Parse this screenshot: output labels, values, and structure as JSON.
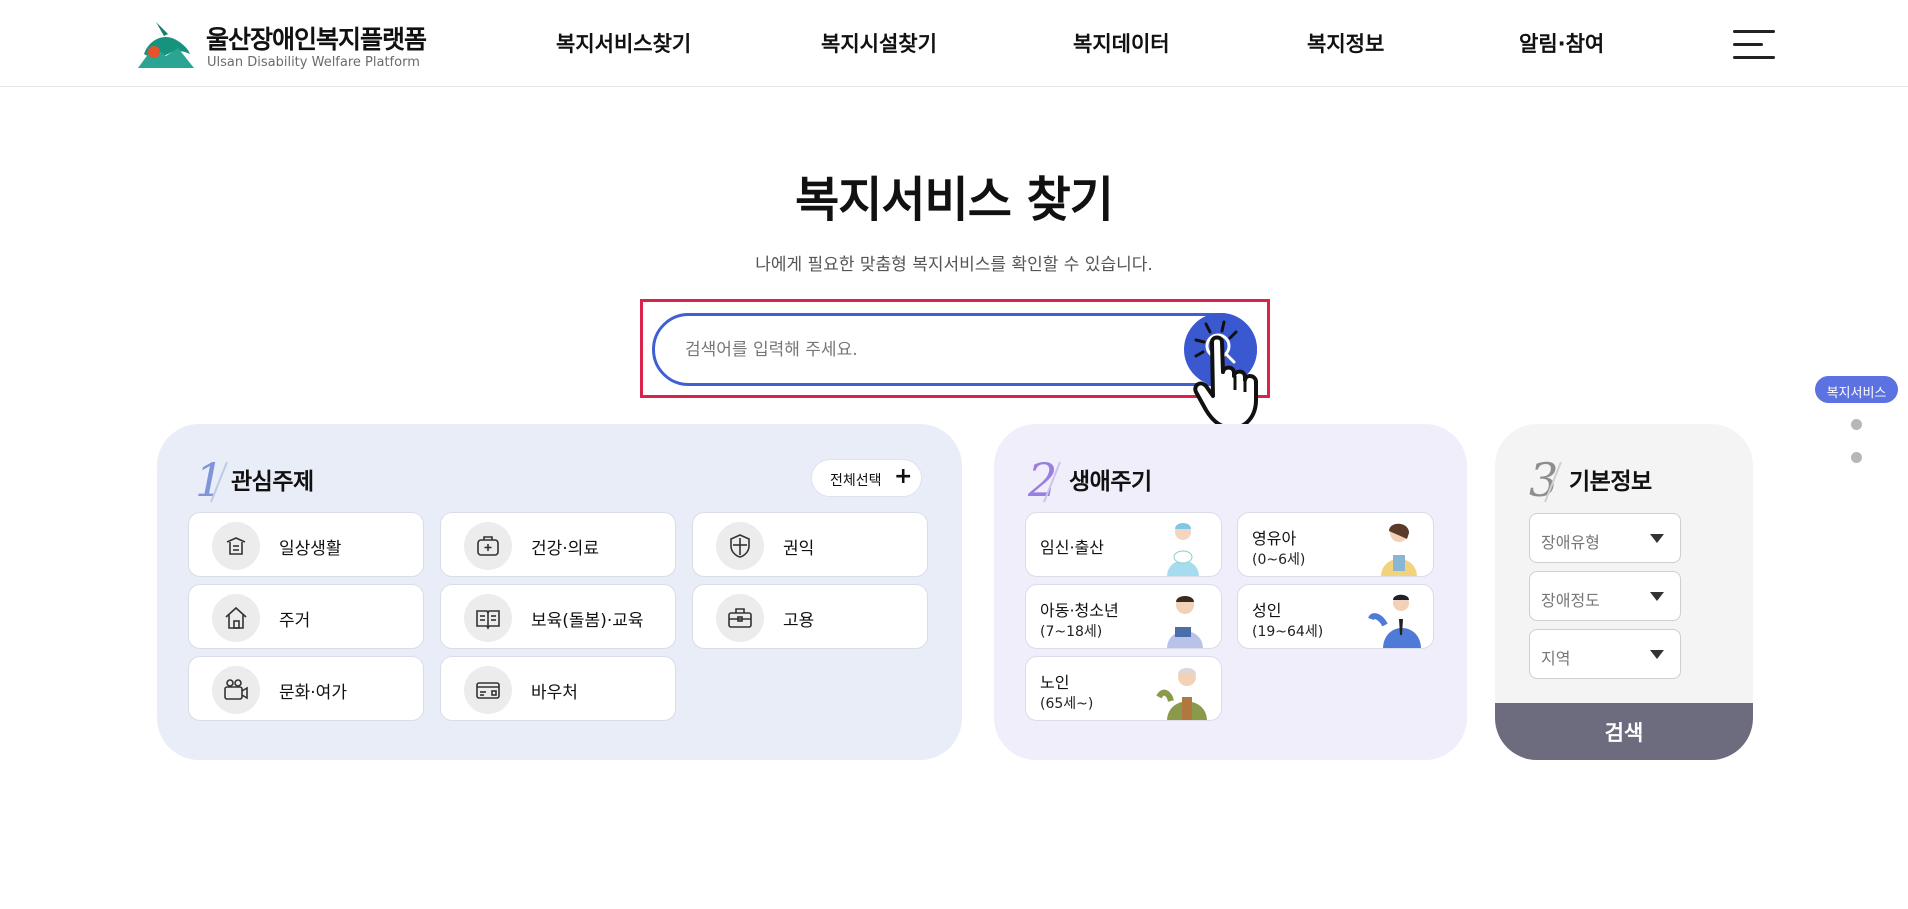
{
  "header": {
    "logo_title": "울산장애인복지플랫폼",
    "logo_subtitle": "Ulsan Disability Welfare Platform",
    "nav": [
      {
        "label": "복지서비스찾기"
      },
      {
        "label": "복지시설찾기"
      },
      {
        "label": "복지데이터"
      },
      {
        "label": "복지정보"
      },
      {
        "label": "알림·참여"
      }
    ],
    "menu_icon": "hamburger-icon"
  },
  "main": {
    "title": "복지서비스 찾기",
    "subtitle": "나에게 필요한 맞춤형 복지서비스를 확인할 수 있습니다.",
    "search": {
      "placeholder": "검색어를 입력해 주세요.",
      "value": "",
      "button_icon": "search-icon"
    }
  },
  "interest": {
    "number": "1",
    "title": "관심주제",
    "select_all_label": "전체선택",
    "select_all_icon": "plus-icon",
    "items": [
      {
        "label": "일상생활",
        "icon": "daily-life-icon"
      },
      {
        "label": "건강·의료",
        "icon": "medical-kit-icon"
      },
      {
        "label": "권익",
        "icon": "shield-icon"
      },
      {
        "label": "주거",
        "icon": "house-icon"
      },
      {
        "label": "보육(돌봄)·교육",
        "icon": "book-icon"
      },
      {
        "label": "고용",
        "icon": "briefcase-icon"
      },
      {
        "label": "문화·여가",
        "icon": "video-camera-icon"
      },
      {
        "label": "바우처",
        "icon": "card-icon"
      }
    ]
  },
  "lifecycle": {
    "number": "2",
    "title": "생애주기",
    "items": [
      {
        "label": "임신·출산",
        "sub": ""
      },
      {
        "label": "영유아",
        "sub": "(0~6세)"
      },
      {
        "label": "아동·청소년",
        "sub": "(7~18세)"
      },
      {
        "label": "성인",
        "sub": "(19~64세)"
      },
      {
        "label": "노인",
        "sub": "(65세~)"
      }
    ]
  },
  "basic_info": {
    "number": "3",
    "title": "기본정보",
    "dropdowns": [
      {
        "label": "장애유형"
      },
      {
        "label": "장애정도"
      },
      {
        "label": "지역"
      }
    ],
    "submit_label": "검색"
  },
  "side_indicator": {
    "active_label": "복지서비스"
  },
  "colors": {
    "accent": "#3a58d0",
    "highlight": "#d9234b",
    "panel1": "#e9edf8",
    "panel2": "#f0eefb",
    "submit": "#6c6c7e"
  }
}
